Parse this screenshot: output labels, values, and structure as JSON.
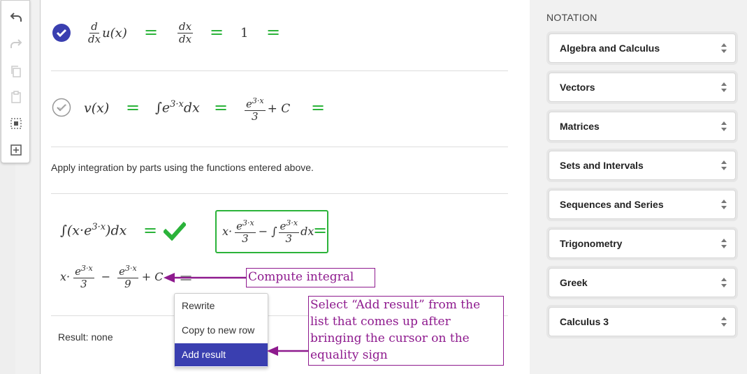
{
  "notation": {
    "title": "NOTATION",
    "items": [
      {
        "label": "Algebra and Calculus"
      },
      {
        "label": "Vectors"
      },
      {
        "label": "Matrices"
      },
      {
        "label": "Sets and Intervals"
      },
      {
        "label": "Sequences and Series"
      },
      {
        "label": "Trigonometry"
      },
      {
        "label": "Greek"
      },
      {
        "label": "Calculus 3"
      }
    ]
  },
  "toolbar": {
    "icons": [
      "undo-icon",
      "redo-icon",
      "copy-icon",
      "paste-icon",
      "select-all-icon",
      "add-block-icon"
    ]
  },
  "rows": {
    "row1": {
      "status": "checked",
      "lhs_num": "d",
      "lhs_den": "dx",
      "lhs_tail": "u(x)",
      "mid_num": "dx",
      "mid_den": "dx",
      "value": "1"
    },
    "row2": {
      "status": "checked-light",
      "lhs": "v(x)",
      "integral": "∫e",
      "integral_exp": "3·x",
      "integral_tail": "dx",
      "res_num_base": "e",
      "res_num_exp": "3·x",
      "res_den": "3",
      "res_tail": "+ C"
    }
  },
  "instruction": "Apply integration by parts using the functions entered above.",
  "step1": {
    "lhs": "∫(x·e",
    "lhs_exp": "3·x",
    "lhs_tail": ")dx",
    "box_a": "x·",
    "box_frac1_num": "e",
    "box_frac1_exp": "3·x",
    "box_frac1_den": "3",
    "box_minus": "− ∫",
    "box_frac2_num": "e",
    "box_frac2_exp": "3·x",
    "box_frac2_den": "3",
    "box_tail": "dx"
  },
  "step2": {
    "a": "x·",
    "f1_num": "e",
    "f1_exp": "3·x",
    "f1_den": "3",
    "minus": "−",
    "f2_num": "e",
    "f2_exp": "3·x",
    "f2_den": "9",
    "tail": "+ C"
  },
  "annotations": {
    "compute": "Compute integral",
    "select": "Select “Add result” from the list that comes up after bringing the cursor on the equality sign"
  },
  "context_menu": {
    "items": [
      "Rewrite",
      "Copy to new row",
      "Add result"
    ],
    "active_index": 2
  },
  "result": "Result: none",
  "colors": {
    "accent_green": "#2bb33a",
    "annotation_purple": "#8e1a8e",
    "menu_active": "#3a3fb0",
    "check_blue": "#3a3fb0"
  }
}
